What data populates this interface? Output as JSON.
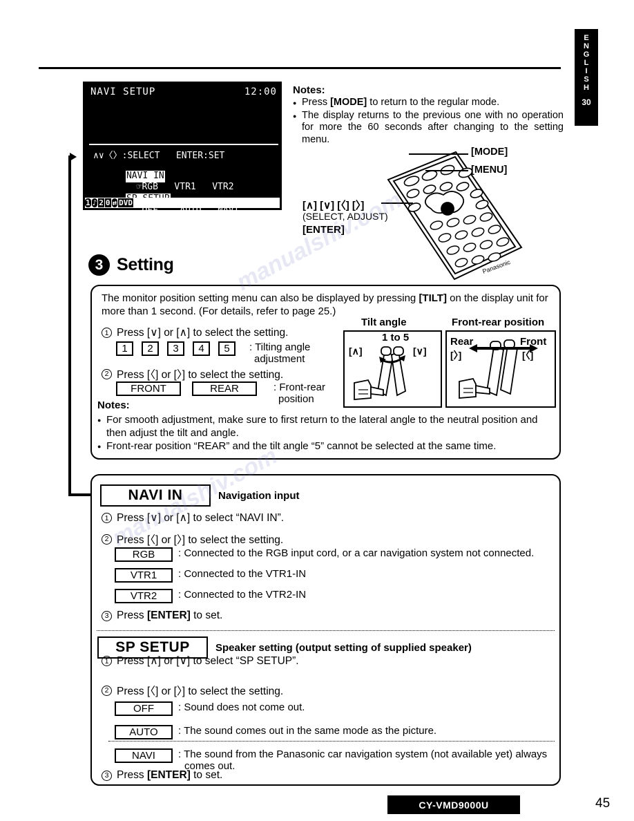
{
  "lang_tab": {
    "letters": [
      "E",
      "N",
      "G",
      "L",
      "I",
      "S",
      "H"
    ],
    "number": "30"
  },
  "osd": {
    "title": "NAVI SETUP",
    "clock": "12:00",
    "hint": "∧∨〈〉:SELECT   ENTER:SET",
    "menu": [
      {
        "label": "NAVI IN",
        "highlighted": true,
        "options": [
          "RGB",
          "VTR1",
          "VTR2"
        ],
        "selected": "RGB"
      },
      {
        "label": "SP SETUP",
        "highlighted": true,
        "options": [
          "OFF",
          "AUTO",
          "NAVI"
        ],
        "selected": ""
      }
    ],
    "status_segments": [
      "1",
      "♪",
      "2",
      "0",
      "⇄",
      "DVD"
    ]
  },
  "notes_top": {
    "heading": "Notes:",
    "items": [
      {
        "pre": "Press ",
        "bold": "[MODE]",
        "post": " to return to the regular mode."
      },
      {
        "pre": "The display returns to the previous one with no operation for more the 60 seconds after changing to the setting menu.",
        "bold": "",
        "post": ""
      }
    ]
  },
  "remote": {
    "callout_mode": "[MODE]",
    "callout_menu": "[MENU]",
    "callout_keys": "[∧] [∨] [〈] [〉]",
    "callout_keys_sub": "(SELECT, ADJUST)",
    "callout_enter": "[ENTER]"
  },
  "step3": {
    "number": "3",
    "title": "Setting",
    "intro_pre": "The monitor position setting menu can also be displayed by pressing ",
    "intro_bold": "[TILT]",
    "intro_post": " on the display unit for more than 1 second. (For details, refer to page 25.)",
    "step1": "Press [∨] or [∧] to select the setting.",
    "tilt_options": [
      "1",
      "2",
      "3",
      "4",
      "5"
    ],
    "tilt_label_l1": ": Tilting angle",
    "tilt_label_l2": "adjustment",
    "step2": "Press [〈] or [〉] to select the setting.",
    "fr_options": [
      "FRONT",
      "REAR"
    ],
    "fr_label_l1": ": Front-rear",
    "fr_label_l2": "position",
    "notes_heading": "Notes:",
    "notes": [
      "For smooth adjustment, make sure to first return to the lateral angle to the neutral position and then adjust the tilt and angle.",
      "Front-rear position “REAR” and the tilt angle “5” cannot be selected at the same time."
    ]
  },
  "diagrams": {
    "tilt": {
      "title": "Tilt angle",
      "range": "1 to 5",
      "left_key": "[∧]",
      "right_key": "[∨]"
    },
    "front_rear": {
      "title": "Front-rear position",
      "left_label": "Rear",
      "left_key": "[〉]",
      "right_label": "Front",
      "right_key": "[〈]"
    }
  },
  "navi_in": {
    "heading": "NAVI IN",
    "description": "Navigation input",
    "step1": "Press [∨] or [∧] to select “NAVI IN”.",
    "step2": "Press [〈] or [〉] to select the setting.",
    "options": [
      {
        "label": "RGB",
        "desc": ": Connected to the RGB input cord, or a car navigation system not connected."
      },
      {
        "label": "VTR1",
        "desc": ": Connected to the VTR1-IN"
      },
      {
        "label": "VTR2",
        "desc": ": Connected to the VTR2-IN"
      }
    ],
    "step3_pre": "Press ",
    "step3_bold": "[ENTER]",
    "step3_post": " to set."
  },
  "sp_setup": {
    "heading": "SP SETUP",
    "description": "Speaker setting (output setting of supplied speaker)",
    "step1": "Press [∧] or [∨] to select “SP SETUP”.",
    "step2": "Press [〈] or [〉] to select the setting.",
    "options": [
      {
        "label": "OFF",
        "desc": ": Sound does not come out.",
        "desc2": ""
      },
      {
        "label": "AUTO",
        "desc": ": The sound comes out in the same mode as the picture.",
        "desc2": ""
      },
      {
        "label": "NAVI",
        "desc": ": The sound from the Panasonic car navigation system (not available yet) always",
        "desc2": "comes out."
      }
    ],
    "step3_pre": "Press ",
    "step3_bold": "[ENTER]",
    "step3_post": " to set."
  },
  "footer": {
    "model": "CY-VMD9000U",
    "page": "45"
  }
}
